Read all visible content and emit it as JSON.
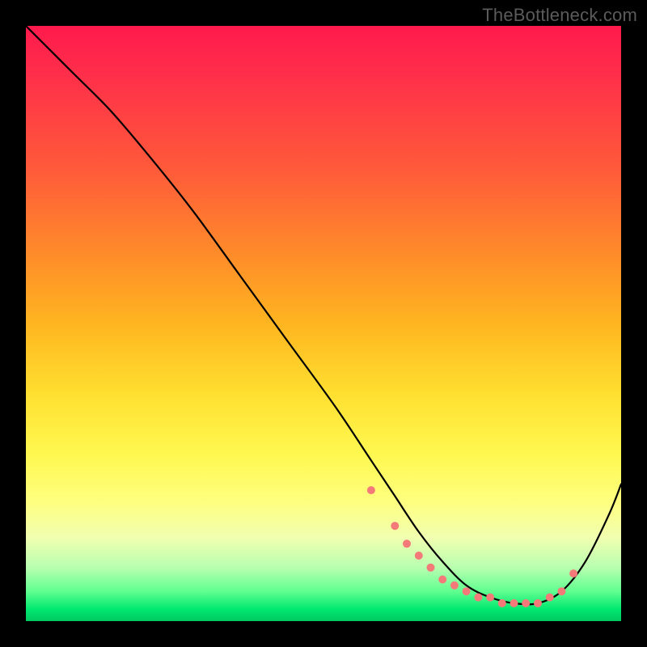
{
  "watermark": "TheBottleneck.com",
  "colors": {
    "gradient_top": "#ff1a4d",
    "gradient_mid1": "#ff8a2a",
    "gradient_mid2": "#ffe030",
    "gradient_bottom": "#00c860",
    "line": "#000000",
    "dots": "#f47a7a",
    "frame": "#000000"
  },
  "chart_data": {
    "type": "line",
    "title": "",
    "xlabel": "",
    "ylabel": "",
    "xlim": [
      0,
      100
    ],
    "ylim": [
      0,
      100
    ],
    "grid": false,
    "legend": false,
    "series": [
      {
        "name": "curve",
        "x": [
          0,
          4,
          8,
          14,
          20,
          28,
          36,
          44,
          52,
          58,
          62,
          66,
          70,
          74,
          78,
          82,
          86,
          90,
          94,
          98,
          100
        ],
        "y": [
          100,
          96,
          92,
          86,
          79,
          69,
          58,
          47,
          36,
          27,
          21,
          15,
          10,
          6,
          4,
          3,
          3,
          5,
          10,
          18,
          23
        ]
      }
    ],
    "points": {
      "name": "dots",
      "x": [
        58,
        62,
        64,
        66,
        68,
        70,
        72,
        74,
        76,
        78,
        80,
        82,
        84,
        86,
        88,
        90,
        92
      ],
      "y": [
        22,
        16,
        13,
        11,
        9,
        7,
        6,
        5,
        4,
        4,
        3,
        3,
        3,
        3,
        4,
        5,
        8
      ]
    }
  }
}
